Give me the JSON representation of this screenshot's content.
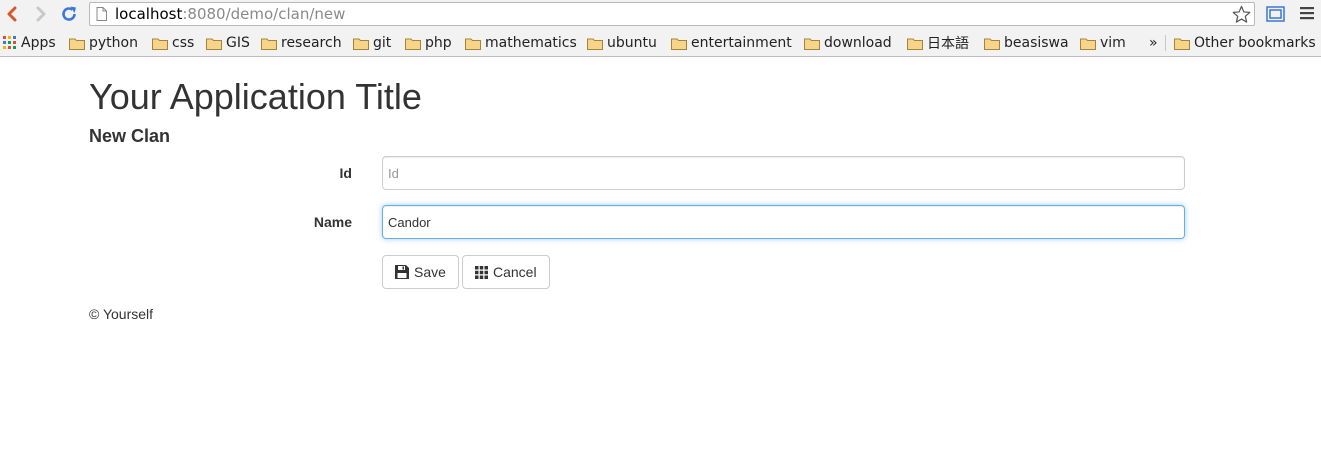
{
  "browser": {
    "url_host": "localhost",
    "url_rest": ":8080/demo/clan/new",
    "icons": {
      "back": "back-arrow-icon",
      "forward": "forward-arrow-icon",
      "reload": "reload-icon",
      "bookmark_star": "star-icon",
      "cast": "cast-icon",
      "menu": "hamburger-menu-icon"
    },
    "bookmarks": {
      "apps_label": "Apps",
      "items": [
        "python",
        "css",
        "GIS",
        "research",
        "git",
        "php",
        "mathematics",
        "ubuntu",
        "entertainment",
        "download",
        "日本語",
        "beasiswa",
        "vim"
      ],
      "overflow": "»",
      "other": "Other bookmarks"
    }
  },
  "page": {
    "app_title": "Your Application Title",
    "subtitle": "New Clan",
    "form": {
      "id_label": "Id",
      "id_placeholder": "Id",
      "id_value": "",
      "name_label": "Name",
      "name_value": "Candor",
      "save_label": "Save",
      "cancel_label": "Cancel"
    },
    "footer": "© Yourself"
  },
  "colors": {
    "focus_border": "#66afe9",
    "text": "#333333",
    "chrome_bg": "#f2f2f2",
    "reload_blue": "#3b78d8",
    "back_orange": "#d9572b"
  }
}
